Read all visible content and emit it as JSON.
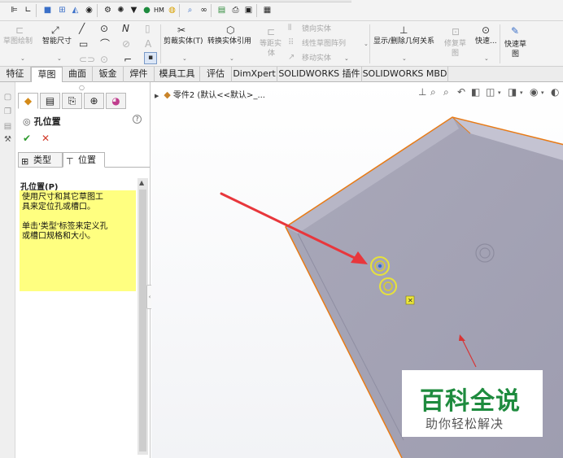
{
  "command_tabs": [
    "特征",
    "草图",
    "曲面",
    "钣金",
    "焊件",
    "模具工具",
    "评估",
    "DimXpert",
    "SOLIDWORKS 插件",
    "SOLIDWORKS MBD"
  ],
  "active_tab": "草图",
  "ribbon": {
    "sketch_label": "草图绘制",
    "smart_dim_label": "智能尺寸",
    "trim_label": "剪裁实体(T)",
    "convert_label": "转换实体引用",
    "offset_label_1": "等距实",
    "offset_label_2": "体",
    "mirror_label": "镜向实体",
    "linear_pattern_label": "线性草图阵列",
    "move_label": "移动实体",
    "show_delete_label": "显示/删除几何关系",
    "repair_label_1": "修复草",
    "repair_label_2": "图",
    "quick_snap_label": "快速...",
    "quick_sketch_label_1": "快速草",
    "quick_sketch_label_2": "图",
    "spline_letter": "N",
    "text_letter": "A"
  },
  "property_manager": {
    "title": "孔位置",
    "subtab_type": "类型",
    "subtab_position": "位置",
    "group_title": "孔位置(P)",
    "message_line_1": "使用尺寸和其它草图工\n具来定位孔或槽口。",
    "message_line_2": "单击'类型'标签来定义孔\n或槽口规格和大小。"
  },
  "graphics": {
    "tree_label": "零件2 (默认<<默认>_..."
  },
  "watermark": {
    "main": "百科全说",
    "sub": "助你轻松解决"
  },
  "colors": {
    "part_face": "#a8a7b8",
    "part_edge": "#e87b16",
    "pointer_arrow": "#e8373c",
    "watermark_green": "#1e8b3e",
    "help_yellow": "#ffff80",
    "hole_highlight": "#e7e23a"
  }
}
